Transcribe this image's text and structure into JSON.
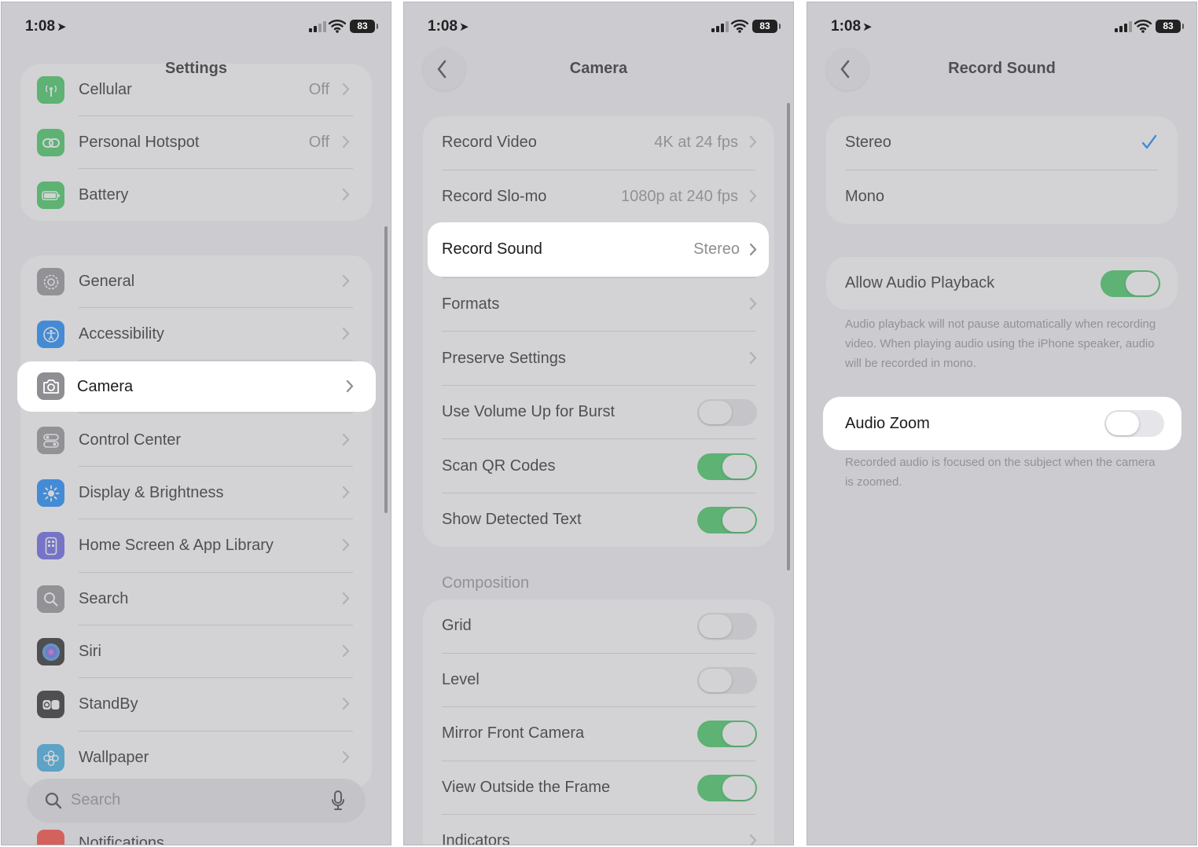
{
  "status": {
    "time": "1:08",
    "battery": "83"
  },
  "panel1": {
    "title": "Settings",
    "top_items": [
      {
        "label": "Cellular",
        "value": "Off",
        "icon": "antenna-icon",
        "color": "#34c759"
      },
      {
        "label": "Personal Hotspot",
        "value": "Off",
        "icon": "link-icon",
        "color": "#34c759"
      },
      {
        "label": "Battery",
        "value": "",
        "icon": "battery-icon",
        "color": "#34c759"
      }
    ],
    "items": [
      {
        "label": "General",
        "icon": "gear-icon",
        "color": "#8e8e93"
      },
      {
        "label": "Accessibility",
        "icon": "accessibility-icon",
        "color": "#0a84ff"
      },
      {
        "label": "Camera",
        "icon": "camera-icon",
        "color": "#8e8e93"
      },
      {
        "label": "Control Center",
        "icon": "switches-icon",
        "color": "#8e8e93"
      },
      {
        "label": "Display & Brightness",
        "icon": "sun-icon",
        "color": "#0a84ff"
      },
      {
        "label": "Home Screen & App Library",
        "icon": "phone-grid-icon",
        "color": "#5e5ce6"
      },
      {
        "label": "Search",
        "icon": "search-icon",
        "color": "#8e8e93"
      },
      {
        "label": "Siri",
        "icon": "siri-icon",
        "color": "#5e5ce6"
      },
      {
        "label": "StandBy",
        "icon": "standby-icon",
        "color": "#1c1c1e"
      },
      {
        "label": "Wallpaper",
        "icon": "flower-icon",
        "color": "#32ade6"
      }
    ],
    "search_placeholder": "Search",
    "bottom_peek": "Notifications"
  },
  "panel2": {
    "title": "Camera",
    "rows": [
      {
        "label": "Record Video",
        "value": "4K at 24 fps"
      },
      {
        "label": "Record Slo-mo",
        "value": "1080p at 240 fps"
      },
      {
        "label": "Record Sound",
        "value": "Stereo"
      },
      {
        "label": "Formats",
        "value": ""
      },
      {
        "label": "Preserve Settings",
        "value": ""
      }
    ],
    "toggles": [
      {
        "label": "Use Volume Up for Burst",
        "on": false
      },
      {
        "label": "Scan QR Codes",
        "on": true
      },
      {
        "label": "Show Detected Text",
        "on": true
      }
    ],
    "composition_header": "Composition",
    "composition": [
      {
        "label": "Grid",
        "on": false
      },
      {
        "label": "Level",
        "on": false
      },
      {
        "label": "Mirror Front Camera",
        "on": true
      },
      {
        "label": "View Outside the Frame",
        "on": true
      }
    ],
    "indicators_label": "Indicators"
  },
  "panel3": {
    "title": "Record Sound",
    "options": [
      "Stereo",
      "Mono"
    ],
    "selected": "Stereo",
    "allow_audio_playback": {
      "label": "Allow Audio Playback",
      "on": true
    },
    "allow_note": "Audio playback will not pause automatically when recording video. When playing audio using the iPhone speaker, audio will be recorded in mono.",
    "audio_zoom": {
      "label": "Audio Zoom",
      "on": false
    },
    "zoom_note": "Recorded audio is focused on the subject when the camera is zoomed."
  },
  "colors": {
    "toggle_on": "#34c759",
    "accent": "#0a84ff",
    "background": "#f2f2f7"
  }
}
